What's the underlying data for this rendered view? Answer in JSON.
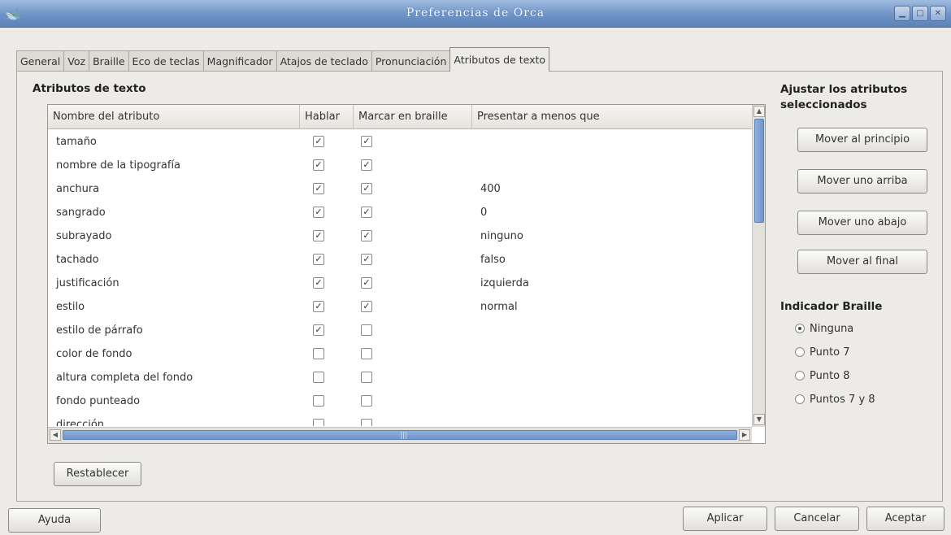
{
  "window": {
    "title": "Preferencias de Orca",
    "app_icon": "orca-whale-icon",
    "controls": [
      "minimize-icon",
      "maximize-icon",
      "close-icon"
    ]
  },
  "tabs": [
    {
      "label": "General",
      "active": false
    },
    {
      "label": "Voz",
      "active": false
    },
    {
      "label": "Braille",
      "active": false
    },
    {
      "label": "Eco de teclas",
      "active": false
    },
    {
      "label": "Magnificador",
      "active": false
    },
    {
      "label": "Atajos de teclado",
      "active": false
    },
    {
      "label": "Pronunciación",
      "active": false
    },
    {
      "label": "Atributos de texto",
      "active": true
    }
  ],
  "attributes": {
    "section_title": "Atributos de texto",
    "columns": [
      "Nombre del atributo",
      "Hablar",
      "Marcar en braille",
      "Presentar a menos que"
    ],
    "rows": [
      {
        "name": "tamaño",
        "speak": true,
        "braille": true,
        "unless": ""
      },
      {
        "name": "nombre de la tipografía",
        "speak": true,
        "braille": true,
        "unless": ""
      },
      {
        "name": "anchura",
        "speak": true,
        "braille": true,
        "unless": "400"
      },
      {
        "name": "sangrado",
        "speak": true,
        "braille": true,
        "unless": "0"
      },
      {
        "name": "subrayado",
        "speak": true,
        "braille": true,
        "unless": "ninguno"
      },
      {
        "name": "tachado",
        "speak": true,
        "braille": true,
        "unless": "falso"
      },
      {
        "name": "justificación",
        "speak": true,
        "braille": true,
        "unless": "izquierda"
      },
      {
        "name": "estilo",
        "speak": true,
        "braille": true,
        "unless": "normal"
      },
      {
        "name": "estilo de párrafo",
        "speak": true,
        "braille": false,
        "unless": ""
      },
      {
        "name": "color de fondo",
        "speak": false,
        "braille": false,
        "unless": ""
      },
      {
        "name": "altura completa del fondo",
        "speak": false,
        "braille": false,
        "unless": ""
      },
      {
        "name": "fondo punteado",
        "speak": false,
        "braille": false,
        "unless": ""
      },
      {
        "name": "dirección",
        "speak": false,
        "braille": false,
        "unless": ""
      }
    ],
    "reset_button": "Restablecer"
  },
  "adjust": {
    "title": "Ajustar los atributos seleccionados",
    "buttons": [
      "Mover al principio",
      "Mover uno arriba",
      "Mover uno abajo",
      "Mover al final"
    ]
  },
  "braille_indicator": {
    "title": "Indicador Braille",
    "options": [
      "Ninguna",
      "Punto 7",
      "Punto 8",
      "Puntos 7 y 8"
    ],
    "selected": "Ninguna"
  },
  "footer": {
    "help": "Ayuda",
    "apply": "Aplicar",
    "cancel": "Cancelar",
    "accept": "Aceptar"
  },
  "colors": {
    "titlebar": "#6f93c6",
    "scroll_thumb": "#7fa2d5",
    "window_bg": "#ecebe8"
  }
}
